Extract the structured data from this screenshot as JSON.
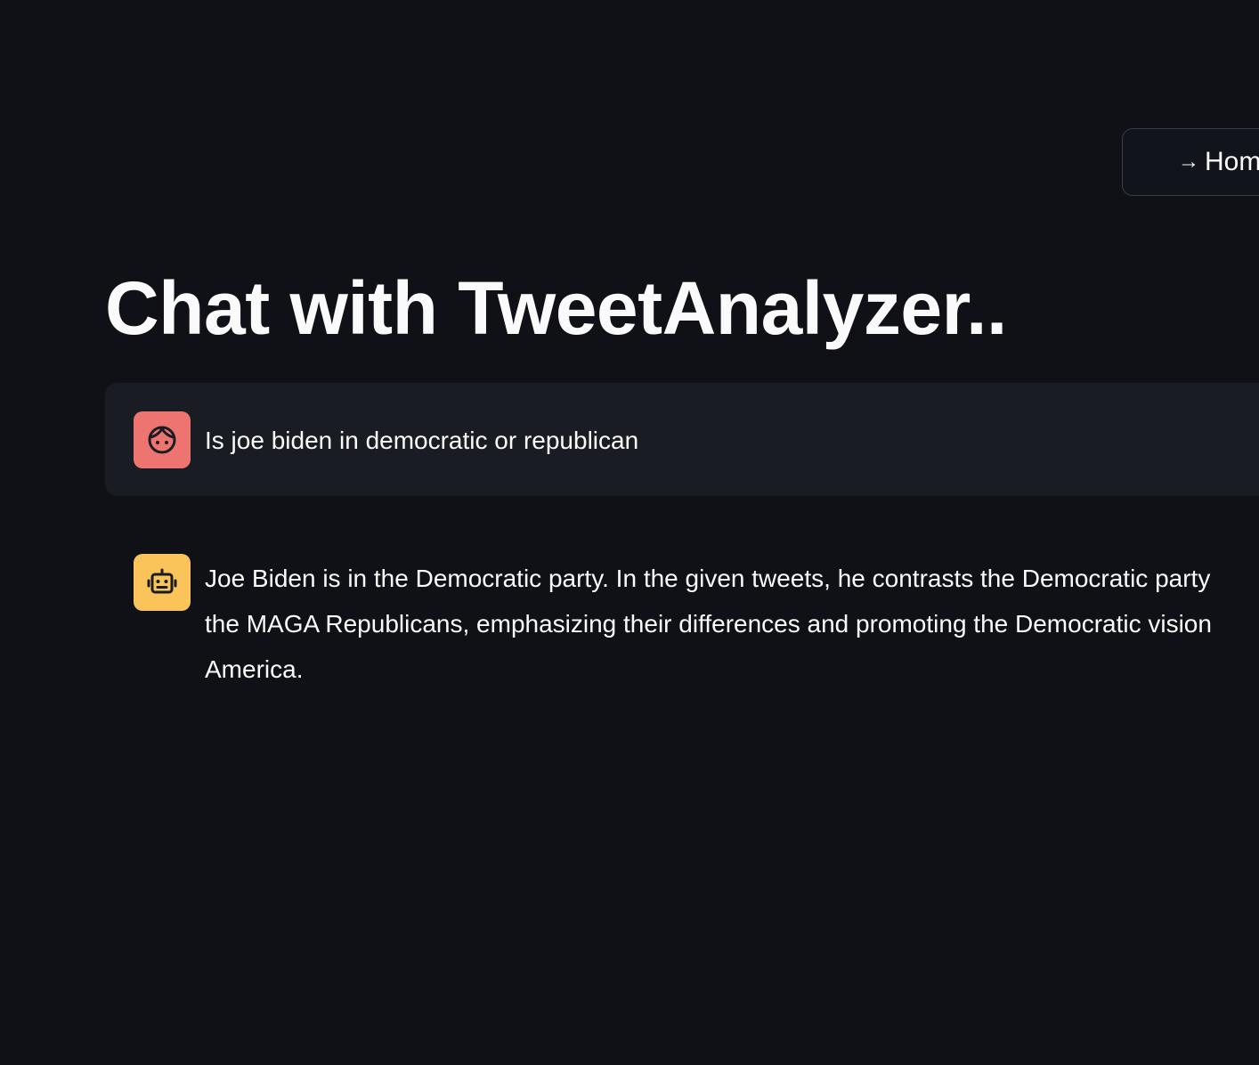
{
  "header": {
    "home_button": {
      "arrow": "→",
      "label": "Home"
    }
  },
  "main": {
    "title": "Chat with TweetAnalyzer.."
  },
  "chat": {
    "user_message": {
      "avatar_icon": "user-face-icon",
      "avatar_color": "#ee7470",
      "text": "Is joe biden in democratic or republican"
    },
    "assistant_message": {
      "avatar_icon": "robot-icon",
      "avatar_color": "#fbc45a",
      "lines": [
        "Joe Biden is in the Democratic party. In the given tweets, he contrasts the Democratic party",
        "the MAGA Republicans, emphasizing their differences and promoting the Democratic vision",
        "America."
      ]
    }
  }
}
